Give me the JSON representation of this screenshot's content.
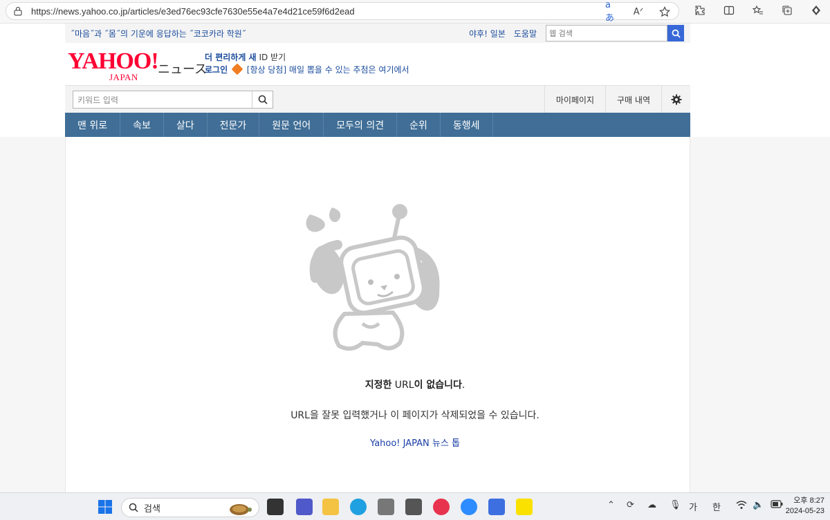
{
  "browser": {
    "url": "https://news.yahoo.co.jp/articles/e3ed76ec93cfe7630e55e4a7e4d21ce59f6d2ead"
  },
  "header": {
    "promo_link": "˝마음˝과 ˝몸˝의 기운에 응답하는 ˝코코카라 학원˝",
    "top_links": [
      "야후! 일본",
      "도움말"
    ],
    "web_search_placeholder": "웹 검색",
    "logo_text": "YAHOO!",
    "logo_sub": "JAPAN",
    "logo_news": "ニュース",
    "promo_line1_bold": "더 편리하게 새",
    "promo_line1_rest": "ID 받기",
    "promo_line2_bold": "로그인",
    "promo_line2_link": "[항상 당첨] 매일 뽑을 수 있는 추첨은 여기에서",
    "keyword_placeholder": "키워드 입력",
    "user_links": [
      "마이페이지",
      "구매 내역"
    ]
  },
  "nav": {
    "items": [
      "맨 위로",
      "속보",
      "살다",
      "전문가",
      "원문 언어",
      "모두의 의견",
      "순위",
      "동행세"
    ]
  },
  "error": {
    "title_bold1": "지정한",
    "title_mid": "URL",
    "title_bold2": "이 없습니다",
    "title_end": ".",
    "subtitle": "URL을 잘못 입력했거나 이 페이지가 삭제되었을 수 있습니다.",
    "link": "Yahoo! JAPAN 뉴스 톱"
  },
  "taskbar": {
    "search_label": "검색",
    "ime1": "가",
    "ime2": "한",
    "time": "오후 8:27",
    "date": "2024-05-23"
  },
  "colors": {
    "brand_red": "#ff0033",
    "nav_blue": "#406e96",
    "link_blue": "#1a4b9c",
    "search_btn": "#3868d8"
  }
}
